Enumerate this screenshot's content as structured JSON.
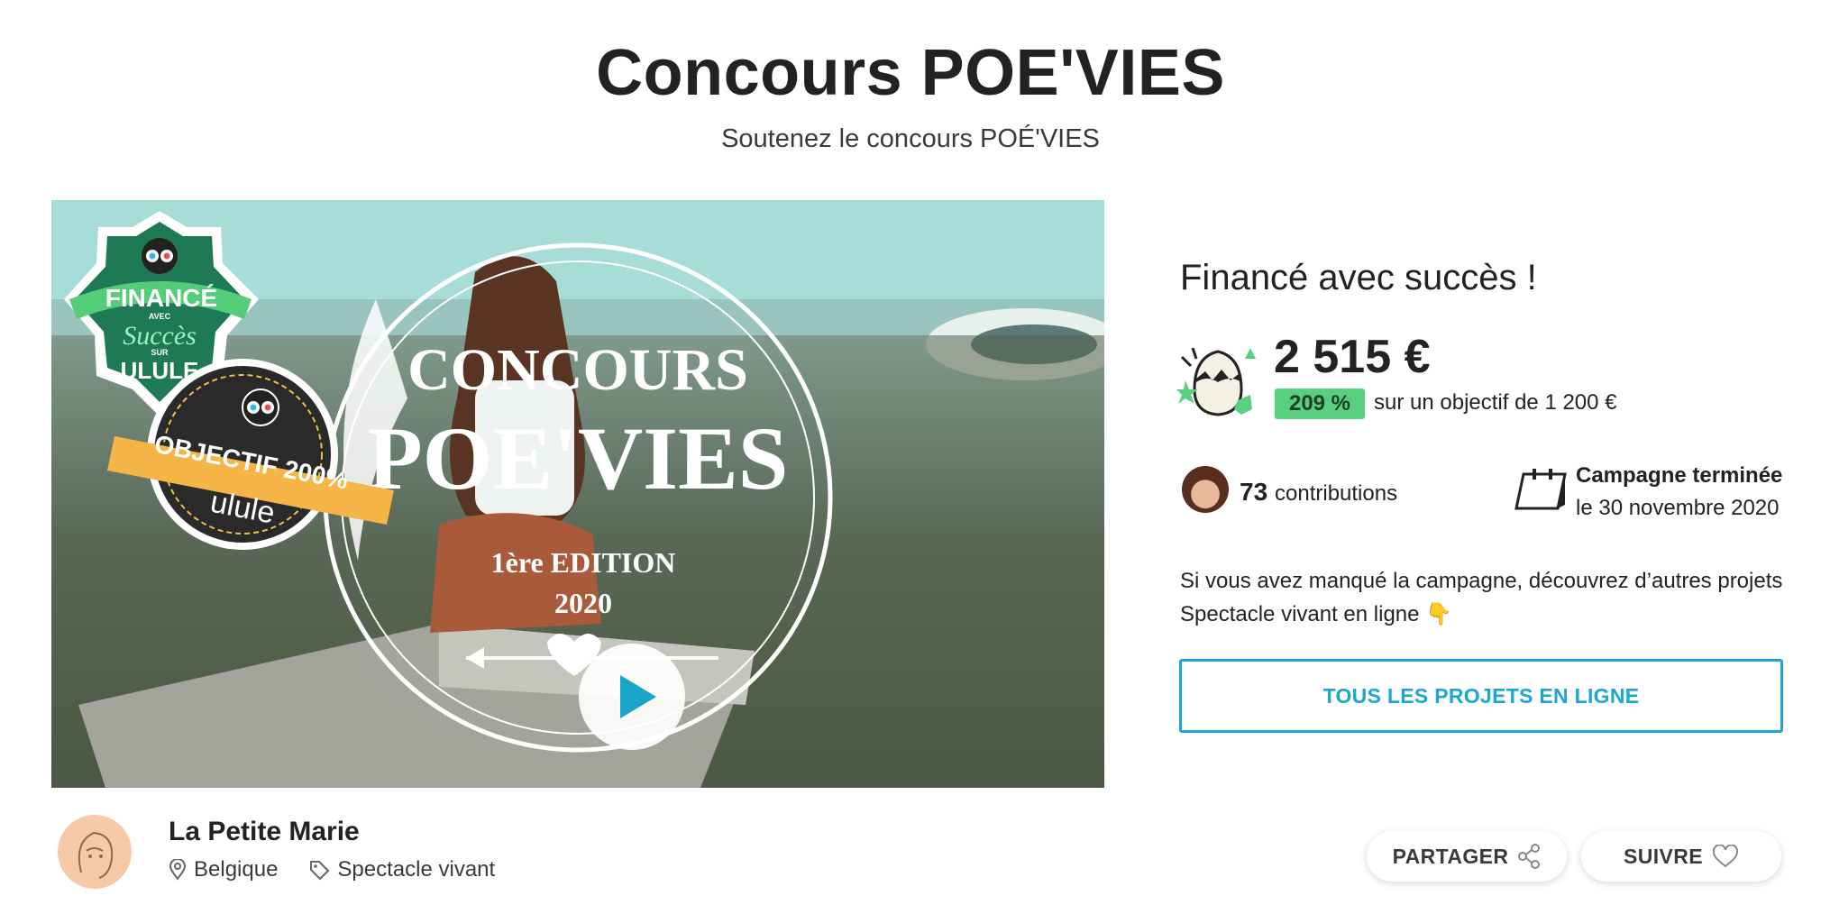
{
  "header": {
    "title": "Concours POE'VIES",
    "subtitle": "Soutenez le concours POÉ'VIES"
  },
  "video": {
    "poster_text_line1": "CONCOURS",
    "poster_text_line2": "POE'VIES",
    "poster_text_line3": "1ère EDITION",
    "poster_text_line4": "2020",
    "badge_financed_top": "FINANCÉ",
    "badge_financed_avec": "AVEC",
    "badge_financed_succes": "Succès",
    "badge_financed_sur": "SUR",
    "badge_financed_brand": "ULULE",
    "badge_objective": "OBJECTIF 200%",
    "badge_objective_brand": "ulule",
    "play_icon": "play-icon"
  },
  "funding": {
    "heading": "Financé avec succès !",
    "amount": "2 515 €",
    "percent": "209 %",
    "goal": "sur un objectif de 1 200 €",
    "percent_value": 209,
    "accent_color": "#59cf80"
  },
  "stats": {
    "contributions_count": "73",
    "contributions_label": "contributions",
    "campaign_status": "Campagne terminée",
    "campaign_date": "le 30 novembre 2020"
  },
  "missed": {
    "text": "Si vous avez manqué la campagne, découvrez d’autres projets Spectacle vivant en ligne 👇"
  },
  "cta": {
    "all_projects_label": "TOUS LES PROJETS EN LIGNE",
    "color": "#1ea6d2"
  },
  "owner": {
    "name": "La Petite Marie",
    "location": "Belgique",
    "category": "Spectacle vivant"
  },
  "actions": {
    "share_label": "PARTAGER",
    "follow_label": "SUIVRE"
  }
}
